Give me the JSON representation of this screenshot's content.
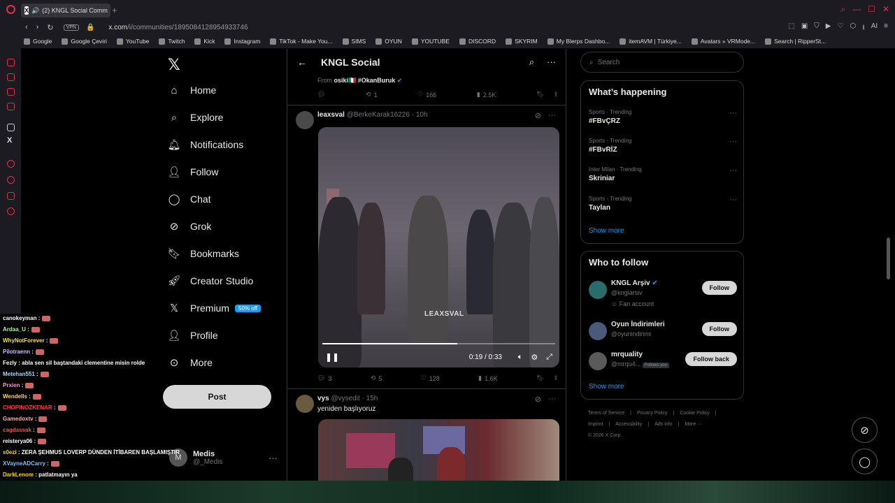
{
  "browser": {
    "tab_title": "(2) KNGL Social Comm",
    "url_host": "x.com",
    "url_path": "/i/communities/1895084128954933746",
    "vpn_label": "VPN",
    "bookmarks": [
      "Google",
      "Google Çeviri",
      "YouTube",
      "Twitch",
      "Kick",
      "Instagram",
      "TikTok - Make You...",
      "SIMS",
      "OYUN",
      "YOUTUBE",
      "DISCORD",
      "SKYRIM",
      "My Blerps Dashbo...",
      "itemAVM | Türkiye...",
      "Avatars » VRMode...",
      "Search | RipperSt..."
    ]
  },
  "nav": {
    "items": [
      "Home",
      "Explore",
      "Notifications",
      "Follow",
      "Chat",
      "Grok",
      "Bookmarks",
      "Creator Studio",
      "Premium",
      "Profile",
      "More"
    ],
    "premium_badge": "50% off",
    "post_label": "Post",
    "account_name": "Medis",
    "account_handle": "@_Medis",
    "account_initial": "M"
  },
  "feed": {
    "title": "KNGL Social",
    "prev_tweet": {
      "from_prefix": "From",
      "from_name": "osiki🇮🇹 #OkanBuruk",
      "retweets": "1",
      "likes": "166",
      "views": "2.5K"
    },
    "tweet1": {
      "name": "leaxsval",
      "handle": "@BerkeKarak16226",
      "time": "· 10h",
      "watermark": "LEAXSVAL",
      "video_time": "0:19 / 0:33",
      "progress": 0.58,
      "replies": "3",
      "retweets": "5",
      "likes": "128",
      "views": "1.6K"
    },
    "tweet2": {
      "name": "vys",
      "handle": "@vysedit",
      "time": "· 15h",
      "text": "yeniden başlıyoruz"
    }
  },
  "right": {
    "search_placeholder": "Search",
    "happening_title": "What’s happening",
    "trends": [
      {
        "meta": "Sports · Trending",
        "name": "#FBvÇRZ"
      },
      {
        "meta": "Sports · Trending",
        "name": "#FBvRİZ"
      },
      {
        "meta": "Inter Milan · Trending",
        "name": "Skriniar"
      },
      {
        "meta": "Sports · Trending",
        "name": "Taylan"
      }
    ],
    "show_more": "Show more",
    "wtf_title": "Who to follow",
    "wtf": [
      {
        "name": "KNGL Arşiv",
        "handle": "@knglarsiv",
        "sub": "Fan account",
        "btn": "Follow"
      },
      {
        "name": "Oyun İndirimleri",
        "handle": "@oyunindirimi",
        "sub": "",
        "btn": "Follow"
      },
      {
        "name": "mrquality",
        "handle": "@mrqu4...",
        "sub": "",
        "btn": "Follow back",
        "follows_you": "Follows you"
      }
    ],
    "footer": [
      "Terms of Service",
      "|",
      "Privacy Policy",
      "|",
      "Cookie Policy",
      "|",
      "Imprint",
      "|",
      "Accessibility",
      "|",
      "Ads info",
      "|",
      "More ···",
      "© 2026 X Corp."
    ]
  },
  "chat": [
    {
      "user": "canokeyman",
      "msg": ":",
      "color": "#ffffff"
    },
    {
      "user": "Ardaa_U",
      "msg": ":",
      "color": "#b6f0a0"
    },
    {
      "user": "WhyNotForever",
      "msg": ":",
      "color": "#f0e060"
    },
    {
      "user": "Pilotraenn",
      "msg": ":",
      "color": "#d0c0ff"
    },
    {
      "user": "Fezly",
      "msg": ": abla sen sil baştandaki clementine misin rolde",
      "color": "#ffffff"
    },
    {
      "user": "Metehan551",
      "msg": ":",
      "color": "#a0d8ff"
    },
    {
      "user": "Prxien",
      "msg": ":",
      "color": "#ff9ad0"
    },
    {
      "user": "Wendells",
      "msg": ":",
      "color": "#ffd27a"
    },
    {
      "user": "CHOPINOZKENAR",
      "msg": ":",
      "color": "#ff4040"
    },
    {
      "user": "Gamedoxtv",
      "msg": ":",
      "color": "#ffb0a0"
    },
    {
      "user": "cagdassak",
      "msg": ":",
      "color": "#ff5050"
    },
    {
      "user": "reisterya06",
      "msg": ":",
      "color": "#ffffff"
    },
    {
      "user": "s0ezi",
      "msg": ": ZERA ŞEHMUS LOVERP DÜNDEN İTİBAREN BAŞLAMIŞTIR",
      "color": "#ffd700"
    },
    {
      "user": "XVayneADCarry",
      "msg": ":",
      "color": "#80c0ff"
    },
    {
      "user": "DarkLenom",
      "msg": ": patlatmayın ya",
      "color": "#ffd700"
    }
  ]
}
